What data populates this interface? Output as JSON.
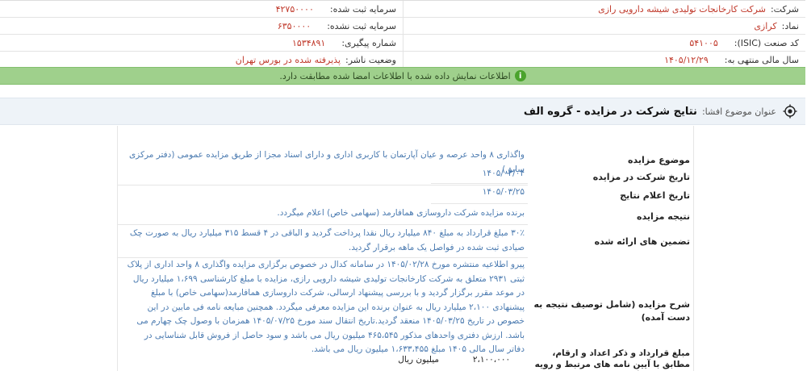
{
  "company_info": {
    "company_label": "شرکت:",
    "company_value": "شرکت کارخانجات تولیدی شیشه دارویی رازی",
    "registered_capital_label": "سرمایه ثبت شده:",
    "registered_capital_value": "۴۲۷۵۰۰۰۰",
    "symbol_label": "نماد:",
    "symbol_value": "کرازی",
    "unregistered_capital_label": "سرمایه ثبت نشده:",
    "unregistered_capital_value": "۶۳۵۰۰۰۰",
    "isic_label": "کد صنعت (ISIC):",
    "isic_value": "۵۴۱۰۰۵",
    "tracking_label": "شماره پیگیری:",
    "tracking_value": "۱۵۳۴۸۹۱",
    "fiscal_year_label": "سال مالی منتهی به:",
    "fiscal_year_value": "۱۴۰۵/۱۲/۲۹",
    "status_label": "وضعیت ناشر:",
    "status_value": "پذیرفته شده در بورس تهران"
  },
  "alert": {
    "message": "اطلاعات نمایش داده شده با اطلاعات امضا شده مطابقت دارد.",
    "icon": "i"
  },
  "subject": {
    "label": "عنوان موضوع افشا:",
    "title": "نتایج شرکت در مزایده - گروه الف"
  },
  "details": [
    {
      "label": "موضوع مزایده",
      "value": "واگذاری ۸ واحد عرصه و عیان آپارتمان با کاربری اداری و دارای اسناد مجزا از طریق مزایده عمومی (دفتر مرکزی سابق)"
    },
    {
      "label": "تاریخ شرکت در مزایده",
      "value": "۱۴۰۵/۰۳/۰۴"
    },
    {
      "label": "تاریخ اعلام نتایج",
      "value": "۱۴۰۵/۰۳/۲۵"
    },
    {
      "label": "نتیجه مزایده",
      "value": "برنده مزایده شرکت داروسازی همافارمد (سهامی خاص) اعلام میگردد."
    },
    {
      "label": "تضمین های ارائه شده",
      "value": "۳۰٪ مبلغ قرارداد به مبلغ ۸۴۰ میلیارد ریال نقدا پرداخت گردید و الباقی در ۴ قسط ۳۱۵ میلیارد ریال به صورت چک صیادی ثبت شده در فواصل یک ماهه برقرار گردید."
    },
    {
      "label": "شرح مزایده (شامل توصیف نتیجه به دست آمده)",
      "value": "پیرو اطلاعیه منتشره مورخ ۱۴۰۵/۰۲/۲۸ در سامانه کدال در خصوص برگزاری مزایده واگذاری ۸ واحد اداری از پلاک ثبتی ۲۹۳۱ متعلق به شرکت کارخانجات تولیدی شیشه دارویی رازی، مزایده با مبلغ کارشناسی ۱،۶۹۹ میلیارد ریال در موعد مقرر برگزار گردید و با بررسی پیشنهاد ارسالی، شرکت داروسازی همافارمد(سهامی خاص) با مبلغ پیشنهادی ۲،۱۰۰ میلیارد ریال به عنوان برنده این مزایده معرفی میگردد. همچنین مبایعه نامه فی مابین در این خصوص در تاریخ ۱۴۰۵/۰۳/۲۵ منعقد گردید.تاریخ انتقال سند مورخ ۱۴۰۵/۰۷/۲۵ همزمان با وصول چک چهارم می باشد. ارزش دفتری واحدهای مذکور ۴۶۵،۵۴۵ میلیون ریال می باشد و سود حاصل از فروش قابل شناسایی در دفاتر سال مالی ۱۴۰۵ مبلغ ۱،۶۳۳،۴۵۵ میلیون ریال می باشد."
    },
    {
      "label": "مبلغ قرارداد و ذکر اعداد و ارقام، مطابق با آیین نامه های مرتبط و رویه های جاری (اگر برنده شده باشد)",
      "amount": "۲،۱۰۰،۰۰۰",
      "unit": "میلیون ریال"
    }
  ]
}
